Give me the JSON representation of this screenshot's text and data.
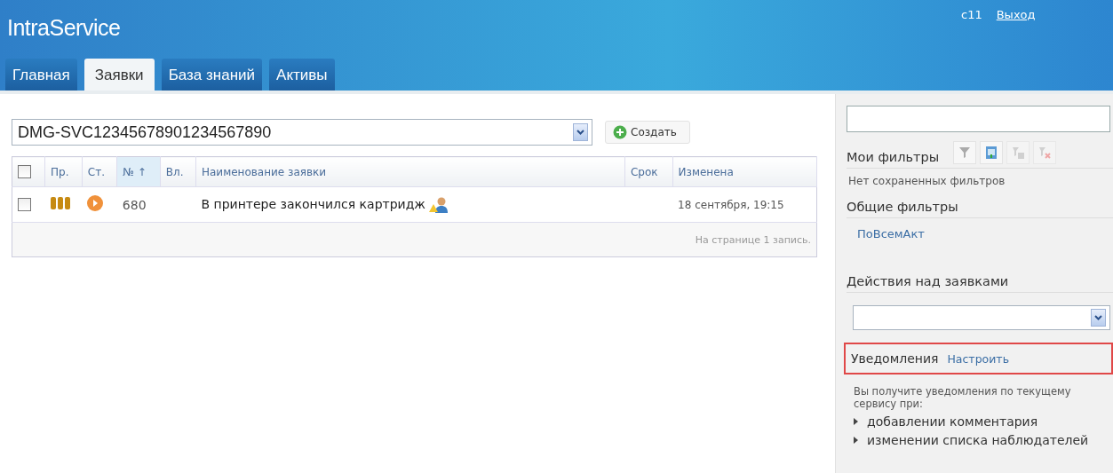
{
  "header": {
    "logo": "IntraService",
    "user": "c11",
    "logout": "Выход"
  },
  "tabs": [
    {
      "label": "Главная",
      "selected": false
    },
    {
      "label": "Заявки",
      "selected": true
    },
    {
      "label": "База знаний",
      "selected": false
    },
    {
      "label": "Активы",
      "selected": false
    }
  ],
  "service_select": {
    "value": "DMG-SVC12345678901234567890"
  },
  "create_button": "Создать",
  "table": {
    "select_all": {
      "checked": false
    },
    "columns": [
      {
        "label": "Пр.",
        "sorted": false
      },
      {
        "label": "Ст.",
        "sorted": false
      },
      {
        "label": "№ ↑",
        "sorted": true
      },
      {
        "label": "Вл.",
        "sorted": false
      },
      {
        "label": "Наименование заявки",
        "sorted": false
      },
      {
        "label": "Срок",
        "sorted": false
      },
      {
        "label": "Изменена",
        "sorted": false
      }
    ],
    "rows": [
      {
        "checked": false,
        "number": "680",
        "title": "В принтере закончился картридж",
        "changed": "18 сентября, 19:15"
      }
    ],
    "footer": "На странице 1 запись."
  },
  "sidebar": {
    "my_filters": {
      "title": "Мои фильтры",
      "tools": [
        {
          "kind": "funnel",
          "disabled": false
        },
        {
          "kind": "table",
          "disabled": false
        },
        {
          "kind": "save",
          "disabled": true
        },
        {
          "kind": "delete",
          "disabled": true
        }
      ],
      "empty": "Нет сохраненных фильтров"
    },
    "common_filters": {
      "title": "Общие фильтры",
      "items": [
        "ПоВсемАкт"
      ]
    },
    "actions": {
      "title": "Действия над заявками"
    },
    "notifications": {
      "title": "Уведомления",
      "configure": "Настроить",
      "text": "Вы получите уведомления по текущему сервису при:",
      "items": [
        "добавлении комментария",
        "изменении списка наблюдателей"
      ]
    }
  }
}
